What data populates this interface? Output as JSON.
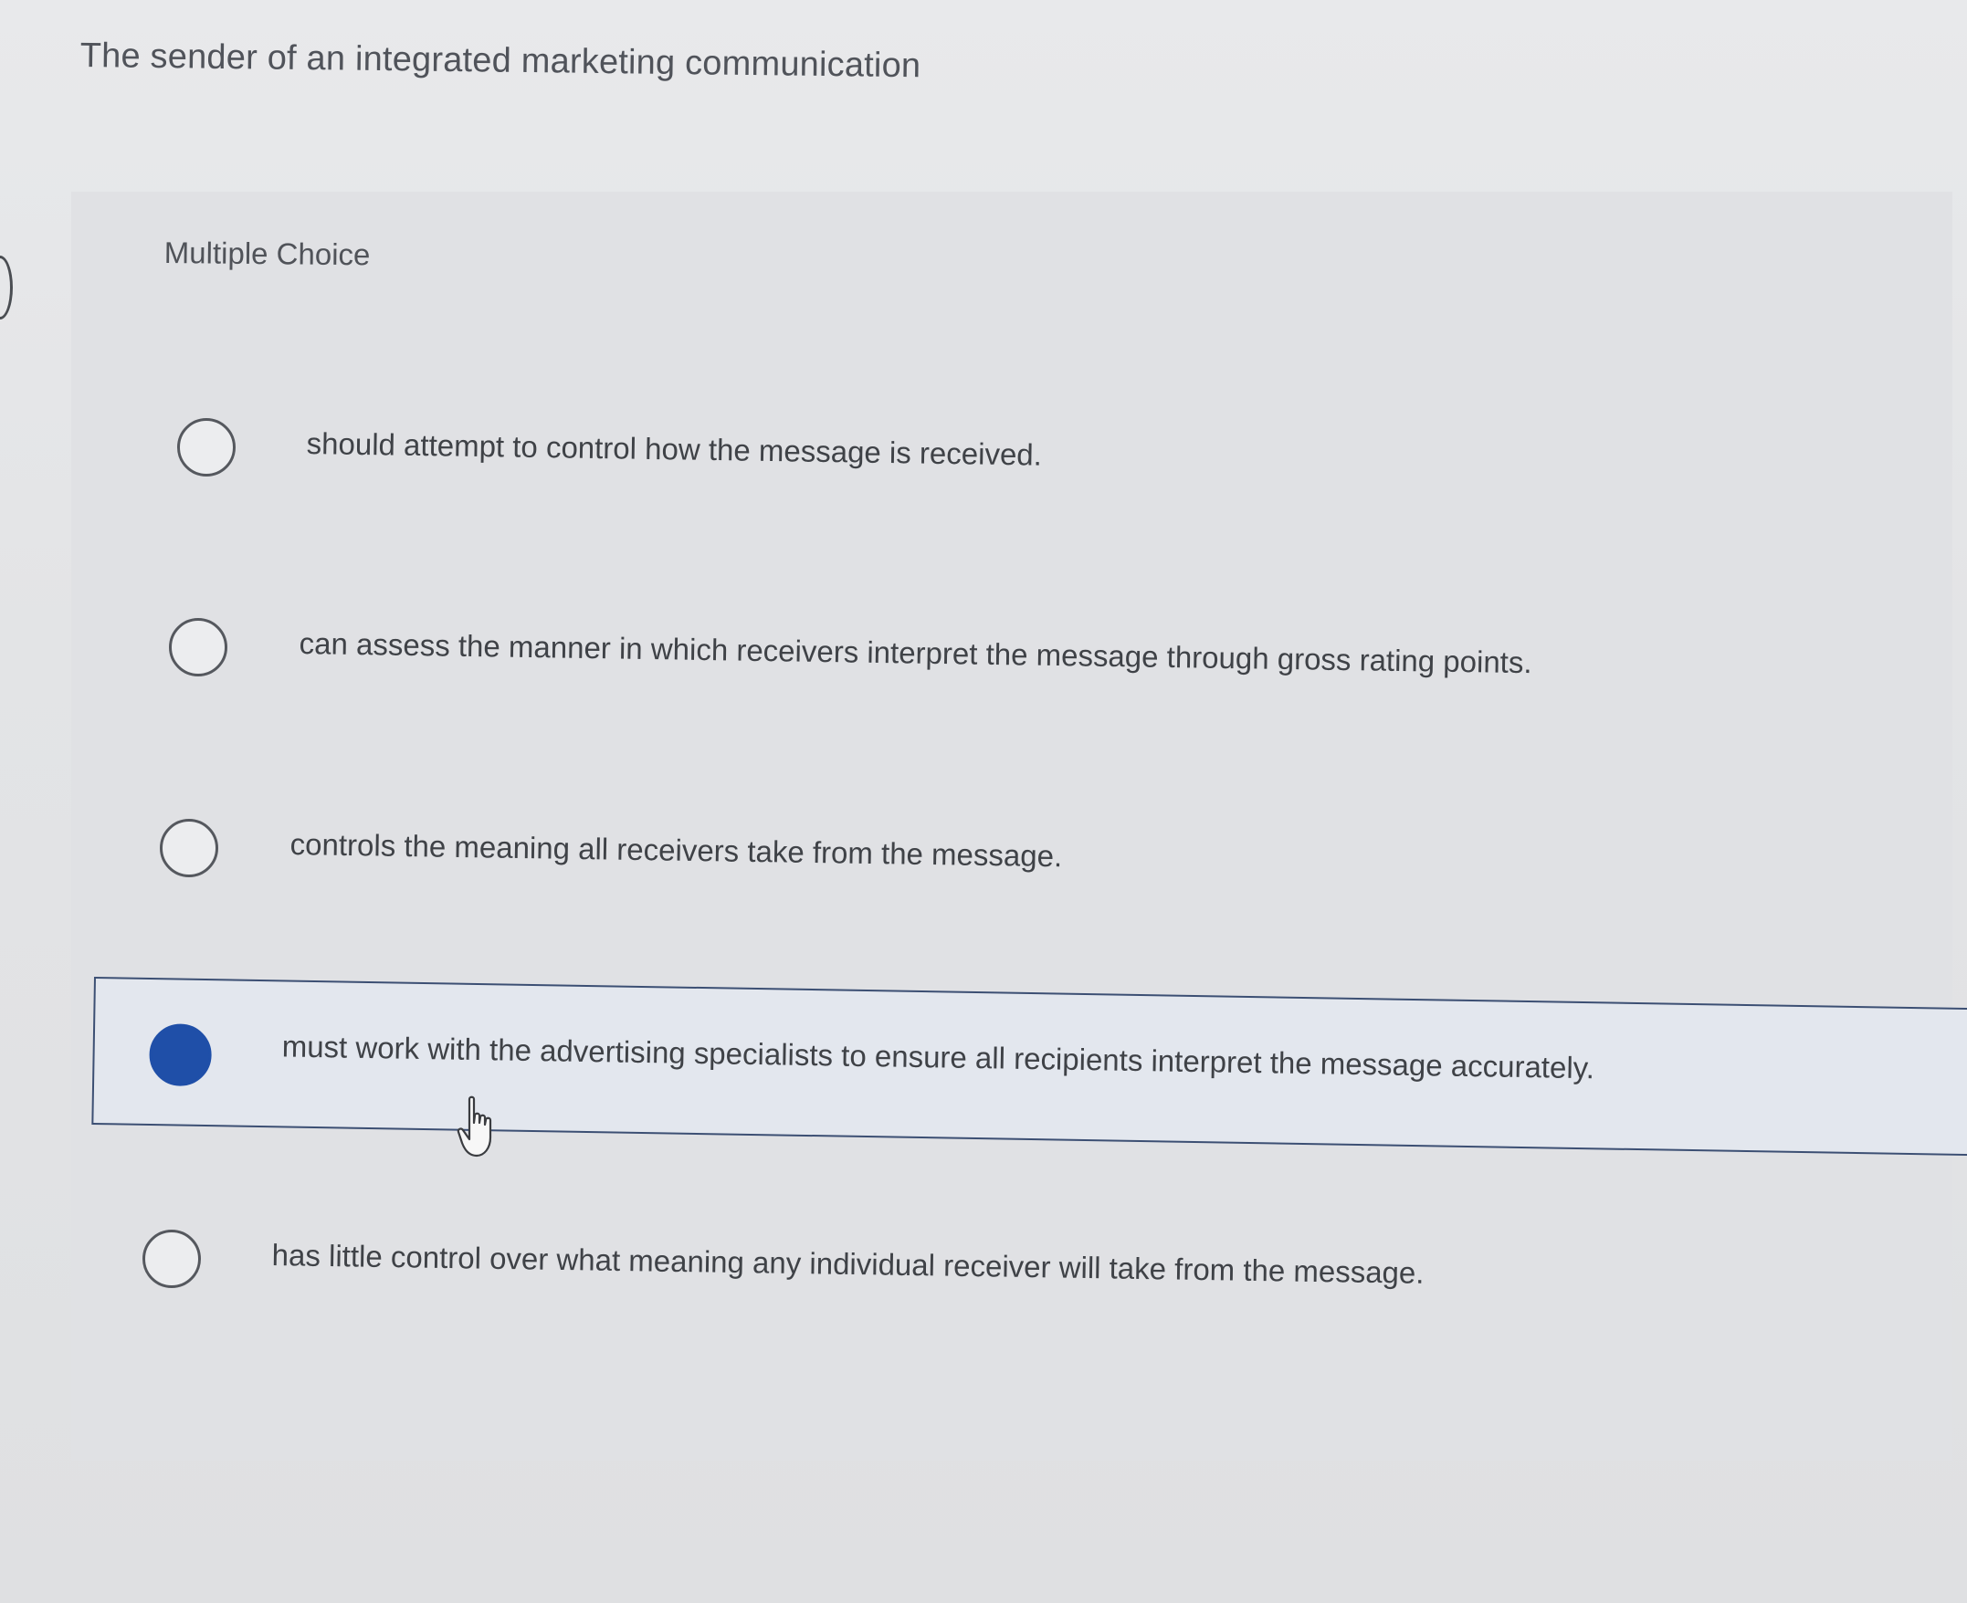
{
  "question": {
    "title": "The sender of an integrated marketing communication",
    "type_label": "Multiple Choice"
  },
  "choices": [
    {
      "text": "should attempt to control how the message is received.",
      "selected": false
    },
    {
      "text": "can assess the manner in which receivers interpret the message through gross rating points.",
      "selected": false
    },
    {
      "text": "controls the meaning all receivers take from the message.",
      "selected": false
    },
    {
      "text": "must work with the advertising specialists to ensure all recipients interpret the message accurately.",
      "selected": true
    },
    {
      "text": "has little control over what meaning any individual receiver will take from the message.",
      "selected": false
    }
  ],
  "colors": {
    "selected_radio": "#1f4fa8",
    "selected_border": "#3c4f73",
    "background": "#e2e3e5"
  },
  "icons": {
    "cursor": "hand-pointer-icon"
  }
}
